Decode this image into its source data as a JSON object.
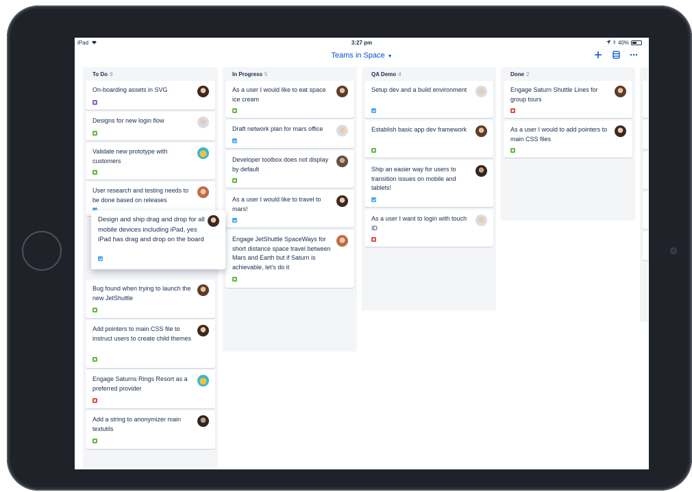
{
  "status_bar": {
    "device": "iPad",
    "time": "3:27 pm",
    "battery": "40%"
  },
  "header": {
    "board_title": "Teams in Space"
  },
  "columns": [
    {
      "title": "To Do",
      "count": "9",
      "cards": [
        {
          "text": "On-boarding assets in SVG",
          "type": "epic",
          "avatar": "av1"
        },
        {
          "text": "Designs for new login flow",
          "type": "story",
          "avatar": "av2"
        },
        {
          "text": "Validate new prototype with customers",
          "type": "story",
          "avatar": "av3"
        },
        {
          "text": "User research and testing needs to be done based on releases",
          "type": "task",
          "avatar": "av4"
        },
        {
          "text": "Bug found when trying to launch the new JetShuttle",
          "type": "story",
          "avatar": "av6"
        },
        {
          "text": "Add pointers to main CSS file to instruct users to create child themes",
          "type": "story",
          "avatar": "av1"
        },
        {
          "text": "Engage Saturns Rings Resort as a preferred provider",
          "type": "bug",
          "avatar": "av3"
        },
        {
          "text": "Add a string to anonymizer main textutils",
          "type": "story",
          "avatar": "av5"
        }
      ]
    },
    {
      "title": "In Progress",
      "count": "5",
      "cards": [
        {
          "text": "As a user I would like to eat space ice cream",
          "type": "story",
          "avatar": "av6"
        },
        {
          "text": "Draft network plan for mars office",
          "type": "task",
          "avatar": "av2"
        },
        {
          "text": "Developer toolbox does not display by default",
          "type": "story",
          "avatar": "av7"
        },
        {
          "text": "As a user I would like to travel to mars!",
          "type": "task",
          "avatar": "av1"
        },
        {
          "text": "Engage JetShuttle SpaceWays for short distance space travel between Mars and Earth but if Saturn is achievable, let's do it",
          "type": "story",
          "avatar": "av4"
        }
      ]
    },
    {
      "title": "QA Demo",
      "count": "4",
      "cards": [
        {
          "text": "Setup dev and a build environment",
          "type": "task",
          "avatar": "av2"
        },
        {
          "text": "Establish basic app dev framework",
          "type": "story",
          "avatar": "av6"
        },
        {
          "text": "Ship an easier way for users to transition issues on mobile and tablets!",
          "type": "task",
          "avatar": "av5"
        },
        {
          "text": "As a user I want to login with touch ID",
          "type": "bug",
          "avatar": "av2"
        }
      ]
    },
    {
      "title": "Done",
      "count": "2",
      "cards": [
        {
          "text": "Engage Saturn Shuttle Lines for group tours",
          "type": "bug",
          "avatar": "av6"
        },
        {
          "text": "As a user I would to add pointers to main CSS files",
          "type": "story",
          "avatar": "av1"
        }
      ]
    }
  ],
  "dragging_card": {
    "text": "Design and ship drag and drop for all mobile devices including iPad, yes iPad has drag and drop on the board",
    "type": "task",
    "avatar": "av1"
  }
}
